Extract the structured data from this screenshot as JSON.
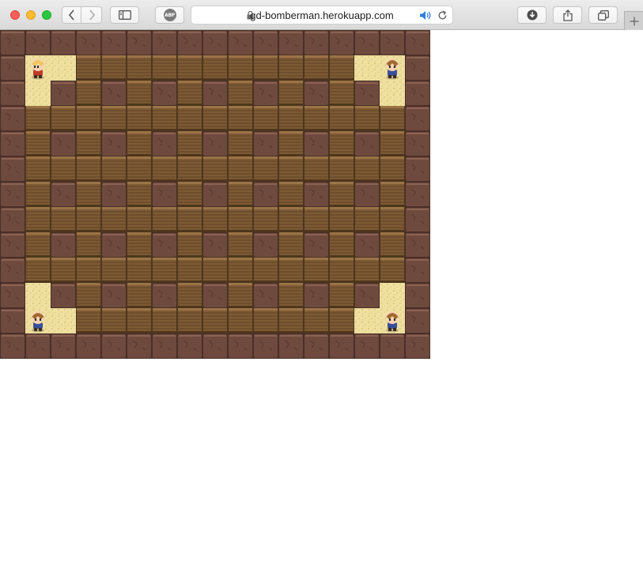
{
  "browser": {
    "url": "gd-bomberman.herokuapp.com",
    "extension_label": "ABP",
    "icons": {
      "back": "chevron-left-icon",
      "forward": "chevron-right-icon",
      "sidebar": "sidebar-icon",
      "lock": "lock-icon",
      "audio": "speaker-icon",
      "reload": "reload-icon",
      "downloads": "download-icon",
      "share": "share-icon",
      "tabs": "tabs-overview-icon",
      "new_tab": "plus-icon"
    }
  },
  "game": {
    "columns": 17,
    "rows": 13,
    "colors": {
      "wall": "#6e4a3e",
      "wall_dark": "#4a2f27",
      "wall_light": "#8a6253",
      "floor": "#7d5a34",
      "floor_line": "#4e361d",
      "floor_light": "#9a7446",
      "spawn": "#efe0a0",
      "spawn_dot": "#d8c57a"
    },
    "spawn_zones": [
      {
        "cells": [
          [
            1,
            1
          ],
          [
            2,
            1
          ],
          [
            1,
            2
          ]
        ]
      },
      {
        "cells": [
          [
            14,
            1
          ],
          [
            15,
            1
          ],
          [
            15,
            2
          ]
        ]
      },
      {
        "cells": [
          [
            1,
            10
          ],
          [
            1,
            11
          ],
          [
            2,
            11
          ]
        ]
      },
      {
        "cells": [
          [
            15,
            10
          ],
          [
            14,
            11
          ],
          [
            15,
            11
          ]
        ]
      }
    ],
    "players": [
      {
        "id": "player-1",
        "col": 1,
        "row": 1,
        "hair": "#f2c65a",
        "shirt": "#c0392b",
        "facing": "left"
      },
      {
        "id": "player-2",
        "col": 15,
        "row": 1,
        "hair": "#a0692e",
        "shirt": "#3a4f9b",
        "facing": "down"
      },
      {
        "id": "player-3",
        "col": 1,
        "row": 11,
        "hair": "#a0692e",
        "shirt": "#3a4f9b",
        "facing": "down"
      },
      {
        "id": "player-4",
        "col": 15,
        "row": 11,
        "hair": "#a0692e",
        "shirt": "#3a4f9b",
        "facing": "down"
      }
    ]
  }
}
